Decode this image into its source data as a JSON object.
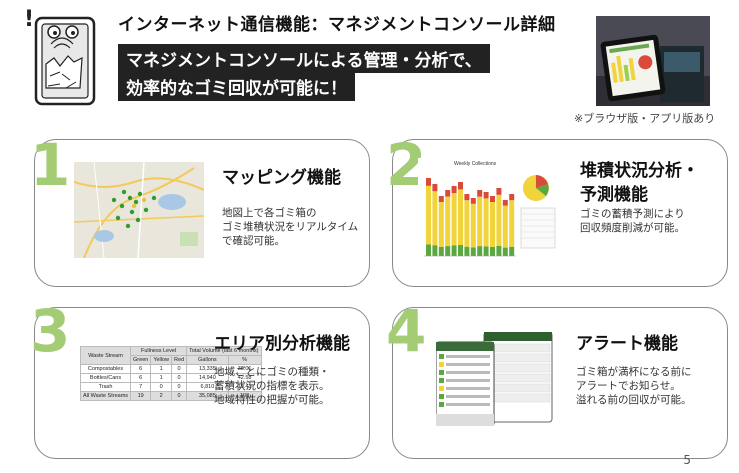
{
  "header": {
    "title": "インターネット通信機能：マネジメントコンソール詳細",
    "tagline1": "マネジメントコンソールによる管理・分析で、",
    "tagline2": "効率的なゴミ回収が可能に！",
    "note": "※ブラウザ版・アプリ版あり"
  },
  "cards": [
    {
      "num": "1",
      "title": "マッピング機能",
      "desc": [
        "地図上で各ゴミ箱の",
        "ゴミ堆積状況をリアルタイム",
        "で確認可能。"
      ]
    },
    {
      "num": "2",
      "title1": "堆積状況分析・",
      "title2": "予測機能",
      "desc": [
        "ゴミの蓄積予測により",
        "回収頻度削減が可能。"
      ]
    },
    {
      "num": "3",
      "title": "エリア別分析機能",
      "desc": [
        "地域ごとにゴミの種類・",
        "蓄積状況の指標を表示。",
        "地域特性の把握が可能。"
      ]
    },
    {
      "num": "4",
      "title": "アラート機能",
      "desc": [
        "ゴミ箱が満杯になる前に",
        "アラートでお知らせ。",
        "溢れる前の回収が可能。"
      ]
    }
  ],
  "chart": {
    "title": "Weekly Collections"
  },
  "area_table": {
    "header_group": "Fullness Level",
    "header_total": "Total Volume (last 6 months)",
    "columns": [
      "Waste Stream",
      "Green",
      "Yellow",
      "Red",
      "Gallons",
      "%"
    ],
    "rows": [
      [
        "Compostables",
        "6",
        "1",
        "0",
        "13,335",
        "38.01"
      ],
      [
        "Bottles/Cans",
        "6",
        "1",
        "0",
        "14,940",
        "42.58"
      ],
      [
        "Trash",
        "7",
        "0",
        "0",
        "6,810",
        "19.41"
      ],
      [
        "All Waste Streams",
        "19",
        "2",
        "0",
        "35,085",
        "100"
      ]
    ]
  },
  "page_number": "5",
  "colors": {
    "accent_number": "#a3cc75",
    "tagline_bg": "#222222"
  }
}
